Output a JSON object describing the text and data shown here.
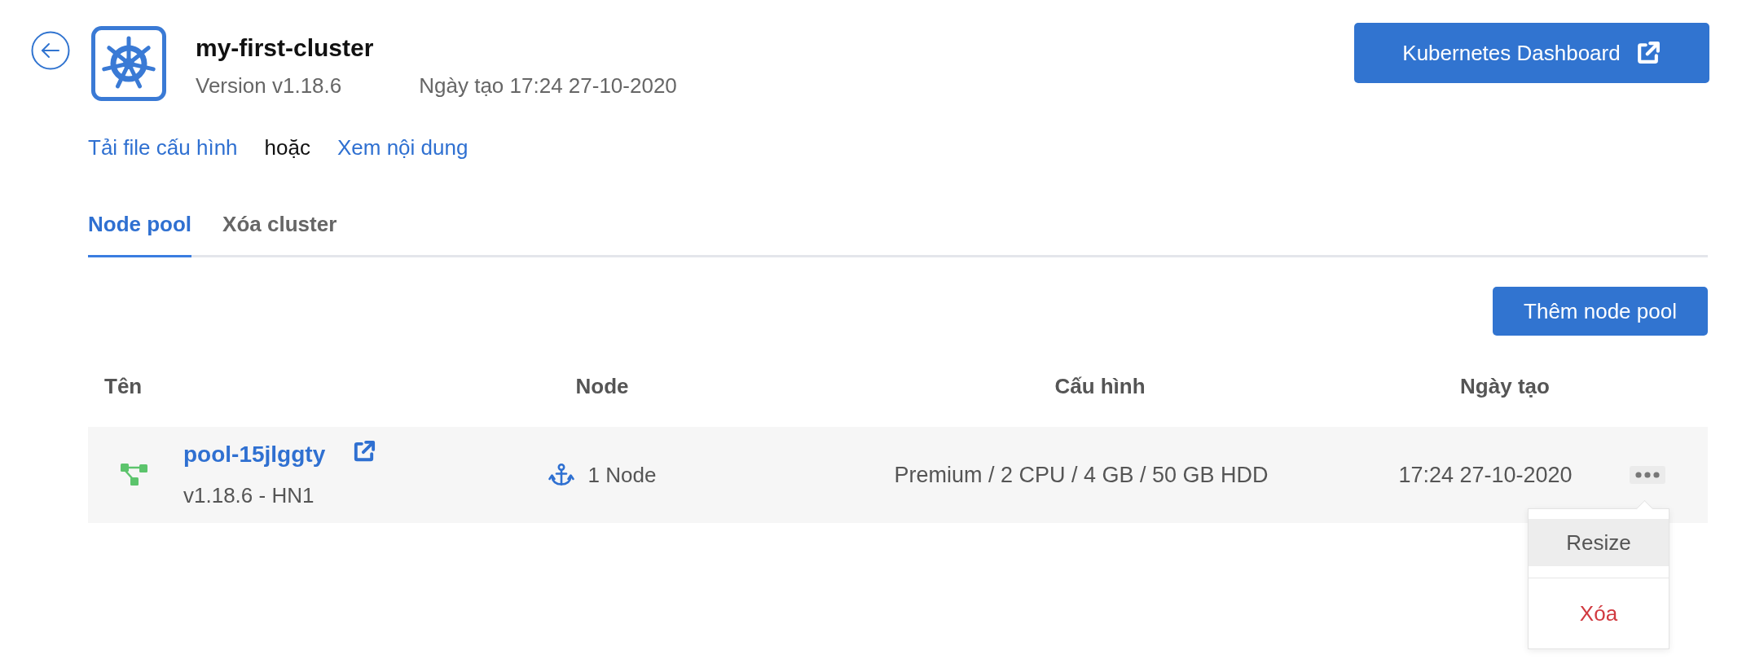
{
  "cluster": {
    "name": "my-first-cluster",
    "version": "Version v1.18.6",
    "created": "Ngày tạo 17:24 27-10-2020"
  },
  "dashboard_button": {
    "label": "Kubernetes Dashboard"
  },
  "config_links": [
    {
      "kind": "link",
      "text": "Tải file cấu hình"
    },
    {
      "kind": "text",
      "text": "hoặc"
    },
    {
      "kind": "link",
      "text": "Xem nội dung"
    }
  ],
  "tabs": [
    {
      "label": "Node pool",
      "selected": true
    },
    {
      "label": "Xóa cluster",
      "selected": false
    }
  ],
  "add_button": {
    "label": "Thêm node pool"
  },
  "table": {
    "columns": [
      "Tên",
      "Node",
      "Cấu hình",
      "Ngày tạo"
    ],
    "rows": [
      {
        "name": "pool-15jlggty",
        "version": "v1.18.6 - HN1",
        "nodes": "1 Node",
        "config": "Premium / 2 CPU / 4 GB / 50 GB HDD",
        "created": "17:24 27-10-2020",
        "menu": {
          "open": true,
          "items": [
            {
              "label": "Resize",
              "kind": "default",
              "highlighted": true
            },
            {
              "label": "Xóa",
              "kind": "danger",
              "highlighted": false
            }
          ]
        }
      }
    ]
  }
}
